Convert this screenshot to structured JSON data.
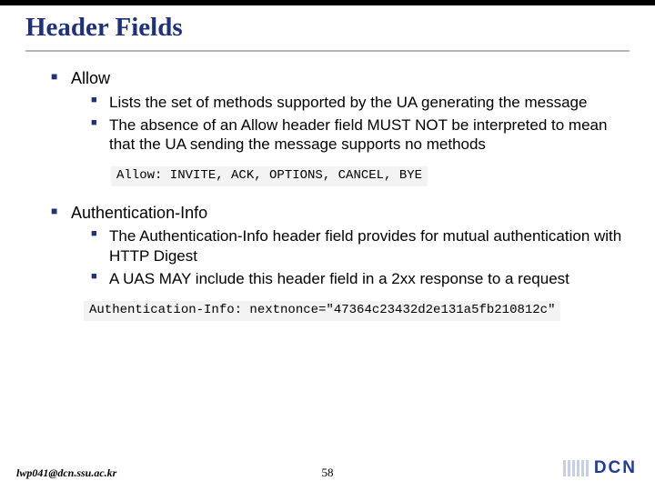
{
  "slide": {
    "title": "Header Fields",
    "sections": [
      {
        "heading": "Allow",
        "points": [
          "Lists the set of methods supported by the UA generating the message",
          "The absence of an Allow header field MUST NOT be interpreted to mean that the UA sending the message supports no methods"
        ],
        "code": "Allow: INVITE, ACK, OPTIONS, CANCEL, BYE"
      },
      {
        "heading": "Authentication-Info",
        "points": [
          "The Authentication-Info header field provides for mutual authentication with HTTP Digest",
          "A UAS MAY include this header field in a 2xx response to a request"
        ],
        "code": "Authentication-Info: nextnonce=\"47364c23432d2e131a5fb210812c\""
      }
    ]
  },
  "footer": {
    "email": "lwp041@dcn.ssu.ac.kr",
    "page": "58",
    "logo_text": "DCN"
  }
}
